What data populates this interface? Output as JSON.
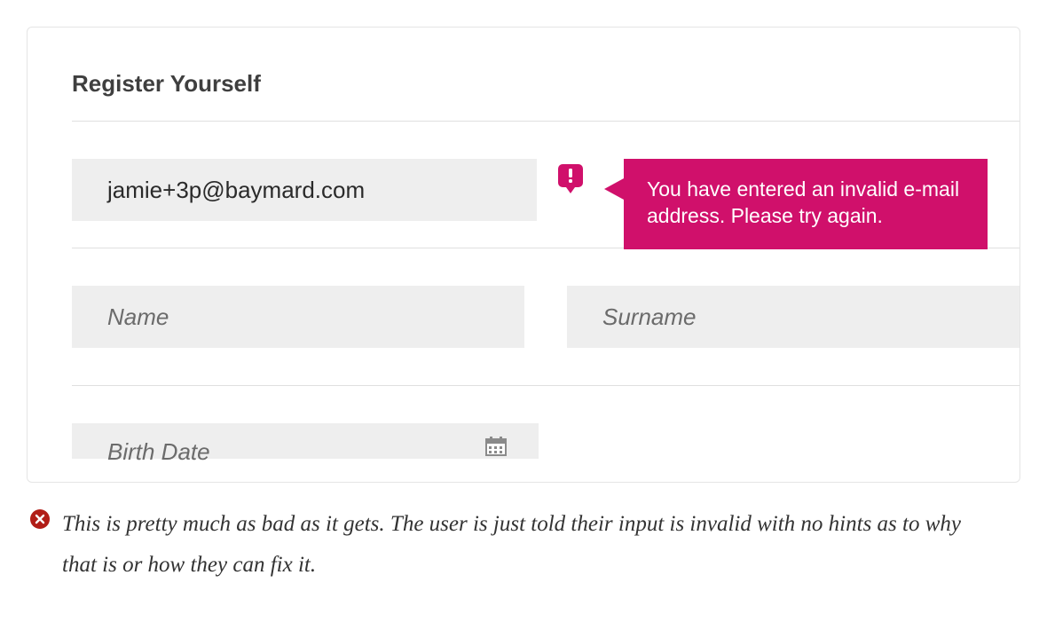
{
  "form": {
    "heading": "Register Yourself",
    "email": {
      "value": "jamie+3p@baymard.com",
      "error": "You have entered an invalid e-mail address. Please try again."
    },
    "name_placeholder": "Name",
    "surname_placeholder": "Surname",
    "birthdate_placeholder": "Birth Date"
  },
  "caption": "This is pretty much as bad as it gets. The user is just told their input is invalid with no hints as to why that is or how they can fix it."
}
